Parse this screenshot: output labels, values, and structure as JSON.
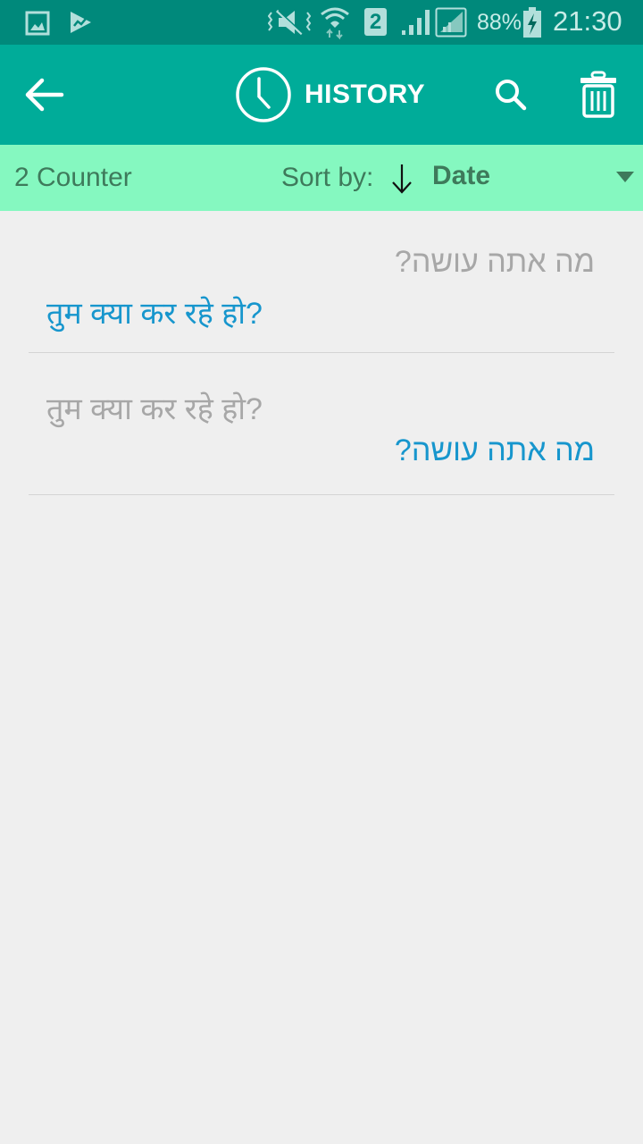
{
  "status_bar": {
    "battery": "88%",
    "time": "21:30",
    "sim_label": "2",
    "icons": [
      "gallery-icon",
      "play-store-icon",
      "vibrate-mute-icon",
      "wifi-icon",
      "sim-2-icon",
      "signal-icon",
      "signal-icon-2",
      "battery-charging-icon"
    ]
  },
  "app_bar": {
    "title": "HISTORY",
    "icons": {
      "back": "back-arrow-icon",
      "title": "clock-icon",
      "search": "search-icon",
      "delete": "trash-icon"
    }
  },
  "sort_bar": {
    "counter": "2 Counter",
    "sort_label": "Sort by:",
    "sort_value": "Date",
    "sort_direction": "descending"
  },
  "history": [
    {
      "source": "מה אתה עושה?",
      "translation": "तुम क्या कर रहे हो?",
      "source_dir": "rtl"
    },
    {
      "source": "तुम क्या कर रहे हो?",
      "translation": "מה אתה עושה?",
      "source_dir": "ltr"
    }
  ],
  "colors": {
    "status_bar": "#00897b",
    "app_bar": "#00ac99",
    "sort_bar": "#85f8c0",
    "source_text": "#a7a7a7",
    "translation_text": "#1796cd"
  }
}
